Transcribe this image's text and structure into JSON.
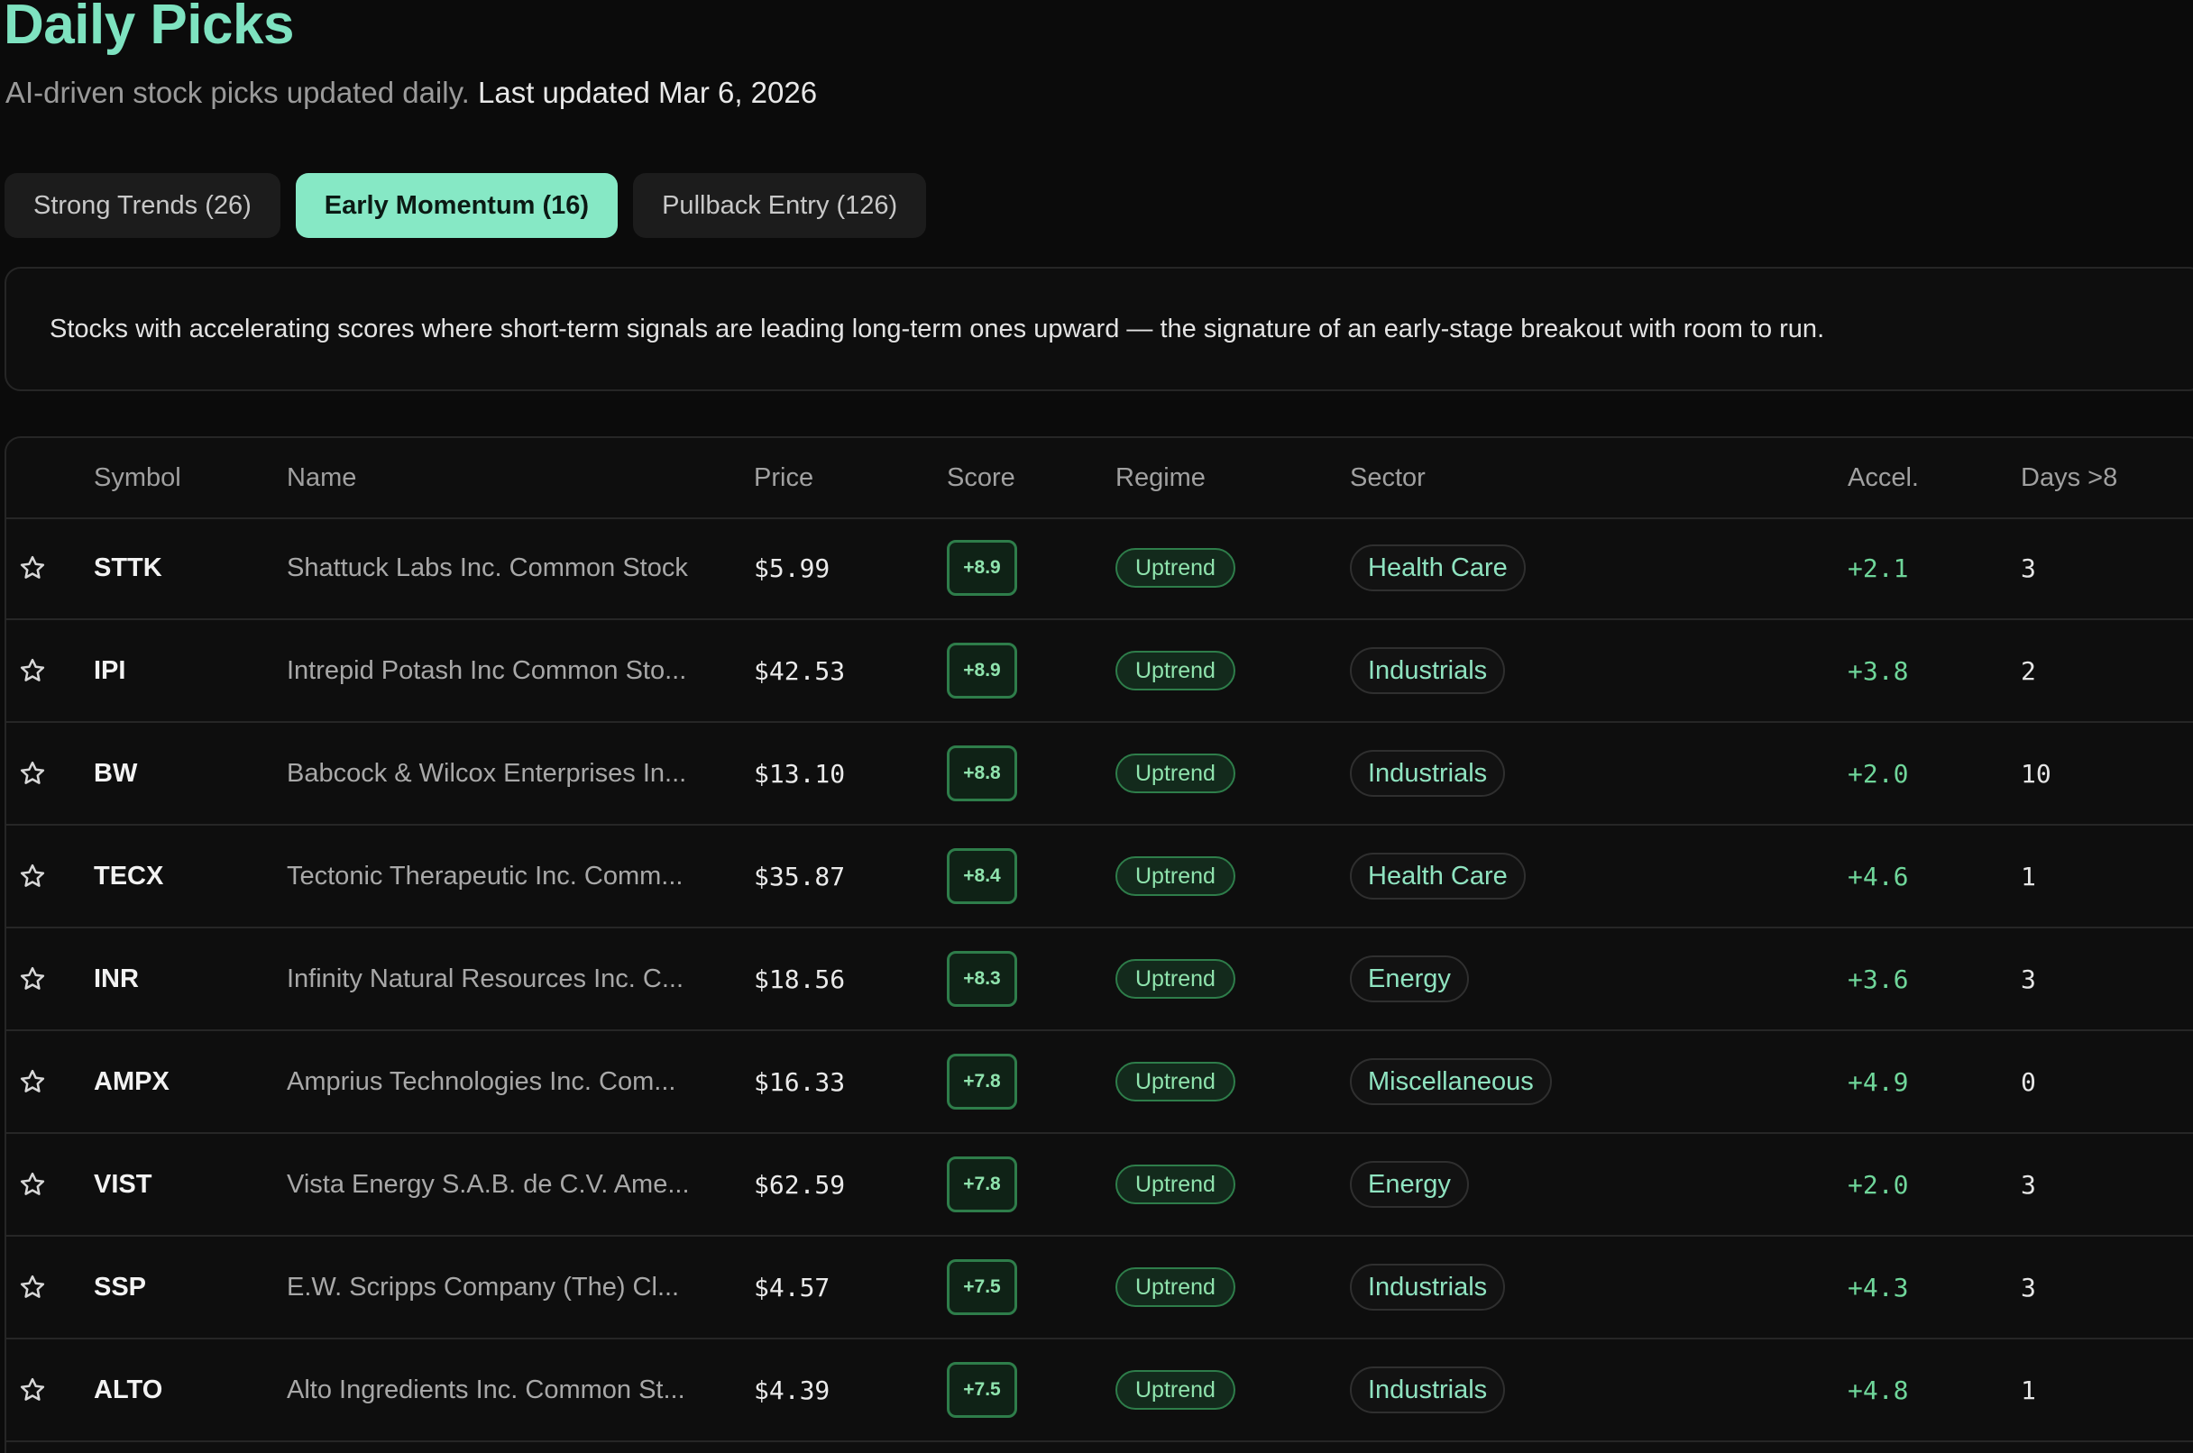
{
  "header": {
    "title": "Daily Picks",
    "subtitle": "AI-driven stock picks updated daily.",
    "last_updated": "Last updated Mar 6, 2026"
  },
  "tabs": [
    {
      "label": "Strong Trends (26)",
      "active": false
    },
    {
      "label": "Early Momentum (16)",
      "active": true
    },
    {
      "label": "Pullback Entry (126)",
      "active": false
    }
  ],
  "description": "Stocks with accelerating scores where short-term signals are leading long-term ones upward — the signature of an early-stage breakout with room to run.",
  "table": {
    "columns": {
      "symbol": "Symbol",
      "name": "Name",
      "price": "Price",
      "score": "Score",
      "regime": "Regime",
      "sector": "Sector",
      "accel": "Accel.",
      "days": "Days >8"
    },
    "rows": [
      {
        "symbol": "STTK",
        "name": "Shattuck Labs Inc. Common Stock",
        "price": "$5.99",
        "score": "+8.9",
        "regime": "Uptrend",
        "sector": "Health Care",
        "accel": "+2.1",
        "days": "3"
      },
      {
        "symbol": "IPI",
        "name": "Intrepid Potash Inc Common Sto...",
        "price": "$42.53",
        "score": "+8.9",
        "regime": "Uptrend",
        "sector": "Industrials",
        "accel": "+3.8",
        "days": "2"
      },
      {
        "symbol": "BW",
        "name": "Babcock & Wilcox Enterprises In...",
        "price": "$13.10",
        "score": "+8.8",
        "regime": "Uptrend",
        "sector": "Industrials",
        "accel": "+2.0",
        "days": "10"
      },
      {
        "symbol": "TECX",
        "name": "Tectonic Therapeutic Inc. Comm...",
        "price": "$35.87",
        "score": "+8.4",
        "regime": "Uptrend",
        "sector": "Health Care",
        "accel": "+4.6",
        "days": "1"
      },
      {
        "symbol": "INR",
        "name": "Infinity Natural Resources Inc. C...",
        "price": "$18.56",
        "score": "+8.3",
        "regime": "Uptrend",
        "sector": "Energy",
        "accel": "+3.6",
        "days": "3"
      },
      {
        "symbol": "AMPX",
        "name": "Amprius Technologies Inc. Com...",
        "price": "$16.33",
        "score": "+7.8",
        "regime": "Uptrend",
        "sector": "Miscellaneous",
        "accel": "+4.9",
        "days": "0"
      },
      {
        "symbol": "VIST",
        "name": "Vista Energy S.A.B. de C.V. Ame...",
        "price": "$62.59",
        "score": "+7.8",
        "regime": "Uptrend",
        "sector": "Energy",
        "accel": "+2.0",
        "days": "3"
      },
      {
        "symbol": "SSP",
        "name": "E.W. Scripps Company (The) Cl...",
        "price": "$4.57",
        "score": "+7.5",
        "regime": "Uptrend",
        "sector": "Industrials",
        "accel": "+4.3",
        "days": "3"
      },
      {
        "symbol": "ALTO",
        "name": "Alto Ingredients Inc. Common St...",
        "price": "$4.39",
        "score": "+7.5",
        "regime": "Uptrend",
        "sector": "Industrials",
        "accel": "+4.8",
        "days": "1"
      }
    ]
  },
  "colors": {
    "accent": "#86e8c5",
    "background": "#0b0b0b",
    "positive": "#6fd69a"
  }
}
